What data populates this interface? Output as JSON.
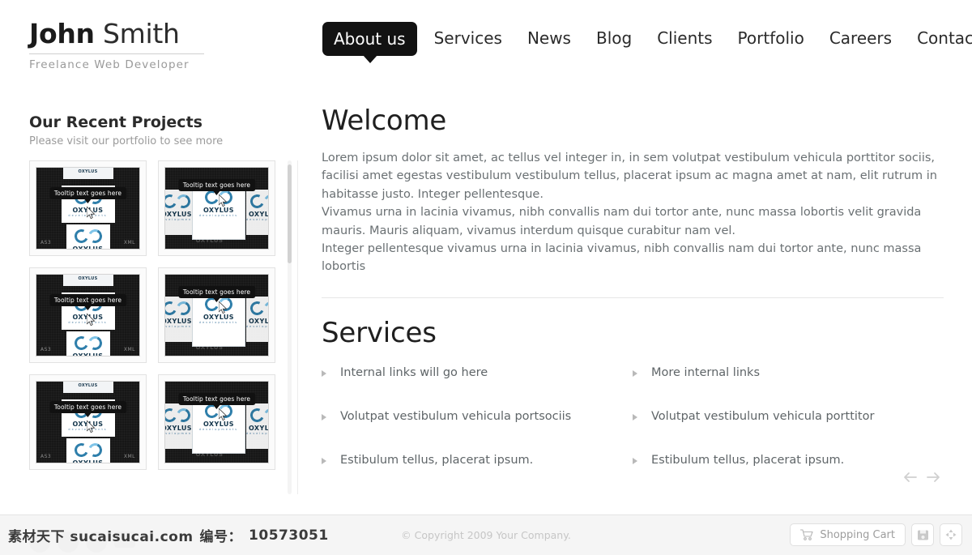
{
  "header": {
    "logo": {
      "first_name": "John",
      "last_name": "Smith",
      "tagline": "Freelance Web Developer"
    },
    "nav": [
      {
        "label": "About us",
        "active": true
      },
      {
        "label": "Services",
        "active": false
      },
      {
        "label": "News",
        "active": false
      },
      {
        "label": "Blog",
        "active": false
      },
      {
        "label": "Clients",
        "active": false
      },
      {
        "label": "Portfolio",
        "active": false
      },
      {
        "label": "Careers",
        "active": false
      },
      {
        "label": "Contact",
        "active": false
      }
    ]
  },
  "sidebar": {
    "title": "Our Recent Projects",
    "subtitle": "Please visit our portfolio to see more",
    "thumbnails": [
      {
        "tooltip": "Tooltip text goes here",
        "brand": "OXYLUS",
        "brand_sub": "developments",
        "corner_left": "AS3",
        "corner_right": "XML",
        "style": "single"
      },
      {
        "tooltip": "Tooltip text goes here",
        "brand": "OXYLUS",
        "brand_sub": "developments",
        "corner_left": "",
        "corner_right": "",
        "style": "carousel"
      },
      {
        "tooltip": "Tooltip text goes here",
        "brand": "OXYLUS",
        "brand_sub": "developments",
        "corner_left": "AS3",
        "corner_right": "XML",
        "style": "single"
      },
      {
        "tooltip": "Tooltip text goes here",
        "brand": "OXYLUS",
        "brand_sub": "developments",
        "corner_left": "",
        "corner_right": "",
        "style": "carousel"
      },
      {
        "tooltip": "Tooltip text goes here",
        "brand": "OXYLUS",
        "brand_sub": "developments",
        "corner_left": "AS3",
        "corner_right": "XML",
        "style": "single"
      },
      {
        "tooltip": "Tooltip text goes here",
        "brand": "OXYLUS",
        "brand_sub": "developments",
        "corner_left": "",
        "corner_right": "",
        "style": "carousel"
      }
    ]
  },
  "main": {
    "welcome_heading": "Welcome",
    "paragraph_1": "Lorem ipsum dolor sit amet, ac tellus vel integer in, in sem volutpat vestibulum vehicula porttitor sociis, facilisi amet egestas vestibulum vestibulum tellus, placerat ipsum ac magna amet at nam, elit rutrum in habitasse justo. Integer pellentesque.",
    "paragraph_2": "Vivamus urna in lacinia vivamus, nibh convallis nam dui tortor ante, nunc massa lobortis velit gravida mauris. Mauris aliquam, vivamus interdum quisque curabitur nam vel.",
    "paragraph_3": "Integer pellentesque vivamus urna in lacinia vivamus, nibh convallis nam dui tortor ante, nunc massa lobortis",
    "services_heading": "Services",
    "services_left": [
      "Internal links will go here",
      "Volutpat vestibulum vehicula portsociis",
      "Estibulum tellus, placerat ipsum."
    ],
    "services_right": [
      "More internal links",
      "Volutpat vestibulum vehicula porttitor",
      "Estibulum tellus, placerat ipsum."
    ],
    "pager": {
      "prev_icon": "arrow-left-icon",
      "next_icon": "arrow-right-icon"
    }
  },
  "footer": {
    "copyright": "© Copyright 2009 Your Company.",
    "cart_label": "Shopping Cart",
    "cart_icon": "shopping-cart-icon",
    "save_icon": "save-icon",
    "move_icon": "move-arrows-icon"
  },
  "watermark": {
    "site": "素材天下 sucaisucai.com",
    "id_label": "编号：",
    "id_value": "10573051"
  },
  "colors": {
    "accent_dark": "#121212",
    "text_body": "#6a7073",
    "heading": "#1f1f1f",
    "muted": "#9b9b9b",
    "footer_bg": "#f5f5f5",
    "brand_blue": "#2f7fab"
  }
}
